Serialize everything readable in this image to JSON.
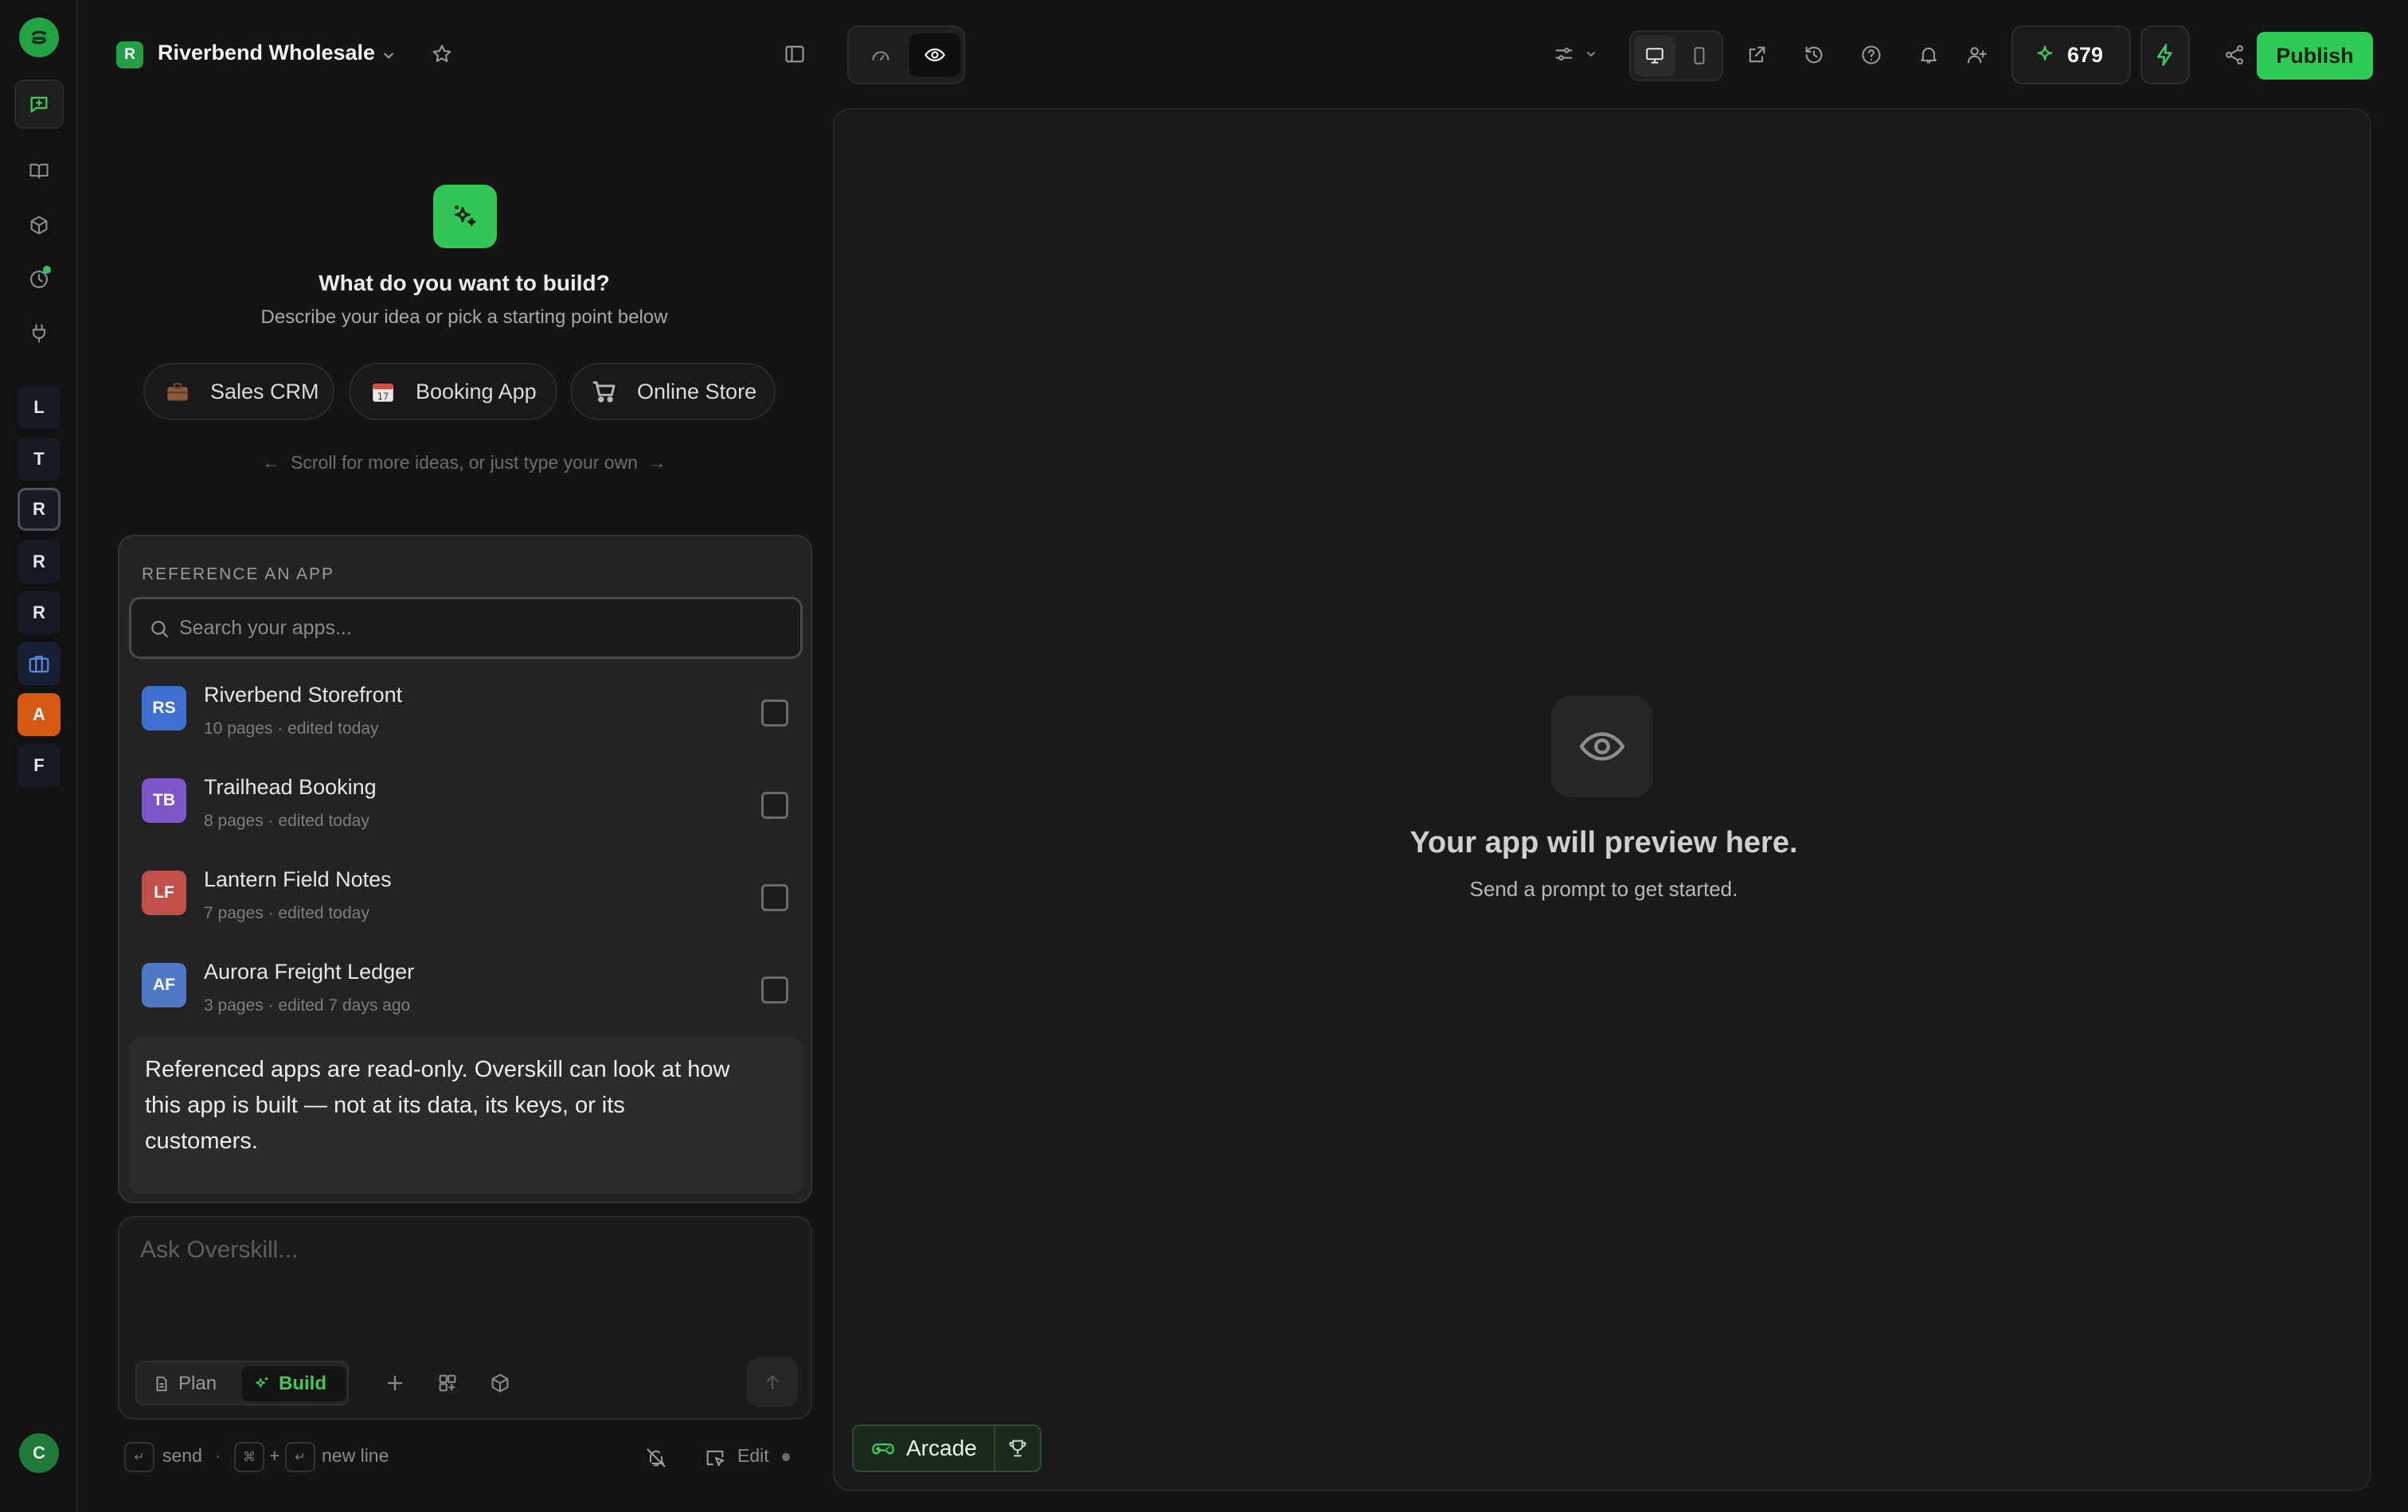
{
  "rail": {
    "workspaces": [
      "L",
      "T",
      "R",
      "R",
      "R",
      "A",
      "F"
    ],
    "user_initial": "C"
  },
  "topbar": {
    "project_badge": "R",
    "project_name": "Riverbend Wholesale",
    "credits": "679",
    "publish_label": "Publish"
  },
  "hero": {
    "title": "What do you want to build?",
    "subtitle": "Describe your idea or pick a starting point below",
    "chips": [
      {
        "label": "Sales CRM",
        "icon": "briefcase-icon"
      },
      {
        "label": "Booking App",
        "icon": "calendar-icon"
      },
      {
        "label": "Online Store",
        "icon": "cart-icon"
      }
    ],
    "scroll_hint": "Scroll for more ideas, or just type your own"
  },
  "reference": {
    "header": "REFERENCE AN APP",
    "search_placeholder": "Search your apps...",
    "apps": [
      {
        "initials": "RS",
        "name": "Riverbend Storefront",
        "meta": "10 pages · edited today",
        "color": "#3f6fd1",
        "checked": false
      },
      {
        "initials": "TB",
        "name": "Trailhead Booking",
        "meta": "8 pages · edited today",
        "color": "#7d57c9",
        "checked": false
      },
      {
        "initials": "LF",
        "name": "Lantern Field Notes",
        "meta": "7 pages · edited today",
        "color": "#c1504b",
        "checked": false
      },
      {
        "initials": "AF",
        "name": "Aurora Freight Ledger",
        "meta": "3 pages · edited 7 days ago",
        "color": "#4f79c6",
        "checked": false
      }
    ],
    "note": "Referenced apps are read-only. Overskill can look at how this app is built — not at its data, its keys, or its customers."
  },
  "composer": {
    "placeholder": "Ask Overskill...",
    "plan_label": "Plan",
    "build_label": "Build",
    "active_mode": "Build"
  },
  "hints": {
    "send": "send",
    "plus": "+",
    "new_line": "new line",
    "dot": "·",
    "edit": "Edit"
  },
  "preview": {
    "title": "Your app will preview here.",
    "subtitle": "Send a prompt to get started.",
    "arcade_label": "Arcade"
  },
  "colors": {
    "accent": "#2ecc55",
    "background": "#141414",
    "panel": "#1a1a1a"
  }
}
